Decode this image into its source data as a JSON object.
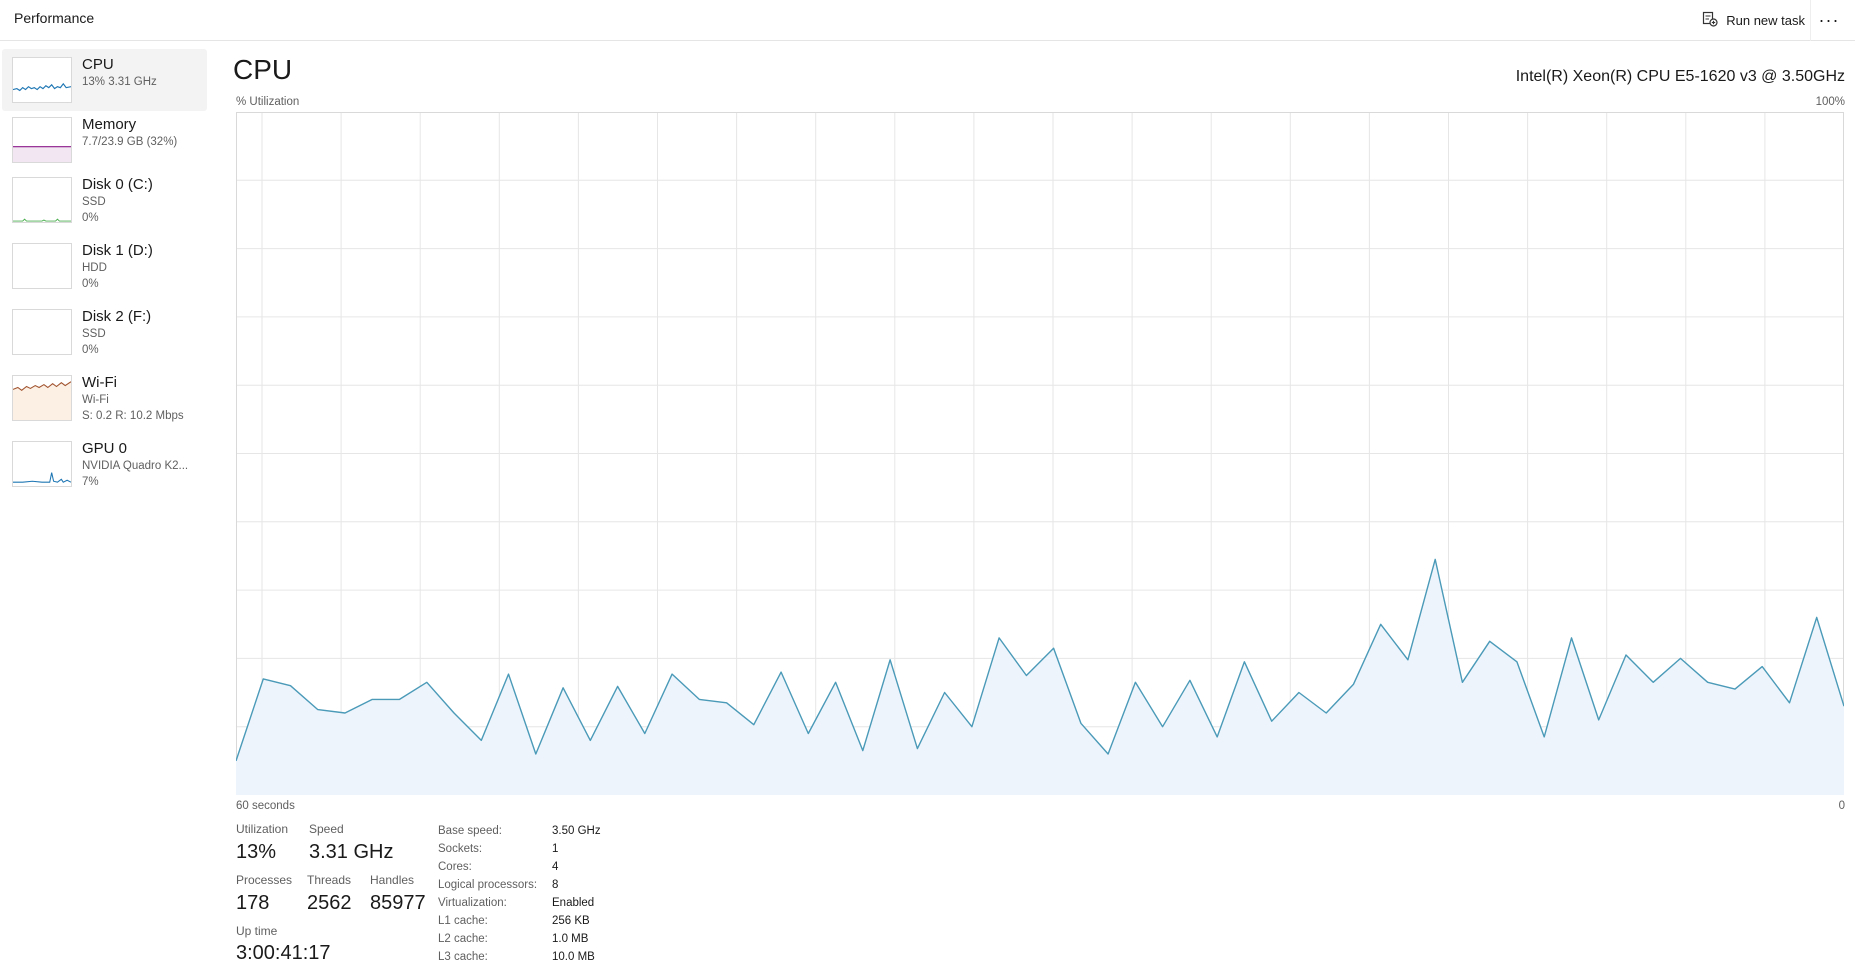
{
  "header": {
    "title": "Performance",
    "run_new_task": "Run new task",
    "more": "···"
  },
  "sidebar": {
    "items": [
      {
        "name": "CPU",
        "line1": "13% 3.31 GHz",
        "line2": "",
        "color": "#1f77b4",
        "fill": "#ffffff"
      },
      {
        "name": "Memory",
        "line1": "7.7/23.9 GB (32%)",
        "line2": "",
        "color": "#8b1a8b",
        "fill": "#f2e6f2"
      },
      {
        "name": "Disk 0 (C:)",
        "line1": "SSD",
        "line2": "0%",
        "color": "#4caf50",
        "fill": "#ffffff"
      },
      {
        "name": "Disk 1 (D:)",
        "line1": "HDD",
        "line2": "0%",
        "color": "#4caf50",
        "fill": "#ffffff"
      },
      {
        "name": "Disk 2 (F:)",
        "line1": "SSD",
        "line2": "0%",
        "color": "#4caf50",
        "fill": "#ffffff"
      },
      {
        "name": "Wi-Fi",
        "line1": "Wi-Fi",
        "line2": "S: 0.2 R: 10.2 Mbps",
        "color": "#a0522d",
        "fill": "#fcefe4"
      },
      {
        "name": "GPU 0",
        "line1": "NVIDIA Quadro K2...",
        "line2": "7%",
        "color": "#1f77b4",
        "fill": "#ffffff"
      }
    ]
  },
  "main": {
    "title": "CPU",
    "model": "Intel(R) Xeon(R) CPU E5-1620 v3 @ 3.50GHz",
    "y_label": "% Utilization",
    "y_max_label": "100%",
    "x_left_label": "60 seconds",
    "x_right_label": "0"
  },
  "chart_data": {
    "type": "area",
    "x_range": [
      60,
      0
    ],
    "ylim": [
      0,
      100
    ],
    "grid": true,
    "line_color": "#4a9ab8",
    "fill_color": "#eef4fb",
    "values": [
      5,
      17,
      16,
      12.5,
      12,
      14,
      14,
      16.5,
      12,
      8,
      17.7,
      6,
      15.7,
      8,
      15.9,
      9,
      17.7,
      14,
      13.5,
      10.3,
      18,
      9,
      16.5,
      6.5,
      19.8,
      6.8,
      15,
      10,
      23,
      17.5,
      21.5,
      10.5,
      6,
      16.5,
      10,
      16.8,
      8.5,
      19.5,
      10.8,
      15,
      12,
      16.2,
      25,
      19.8,
      34.5,
      16.5,
      22.5,
      19.5,
      8.5,
      23,
      11,
      20.5,
      16.5,
      20,
      16.5,
      15.5,
      18.8,
      13.5,
      26,
      13
    ]
  },
  "stats": {
    "utilization": {
      "label": "Utilization",
      "value": "13%"
    },
    "speed": {
      "label": "Speed",
      "value": "3.31 GHz"
    },
    "processes": {
      "label": "Processes",
      "value": "178"
    },
    "threads": {
      "label": "Threads",
      "value": "2562"
    },
    "handles": {
      "label": "Handles",
      "value": "85977"
    },
    "uptime": {
      "label": "Up time",
      "value": "3:00:41:17"
    }
  },
  "info": [
    {
      "key": "Base speed:",
      "value": "3.50 GHz"
    },
    {
      "key": "Sockets:",
      "value": "1"
    },
    {
      "key": "Cores:",
      "value": "4"
    },
    {
      "key": "Logical processors:",
      "value": "8"
    },
    {
      "key": "Virtualization:",
      "value": "Enabled"
    },
    {
      "key": "L1 cache:",
      "value": "256 KB"
    },
    {
      "key": "L2 cache:",
      "value": "1.0 MB"
    },
    {
      "key": "L3 cache:",
      "value": "10.0 MB"
    }
  ]
}
